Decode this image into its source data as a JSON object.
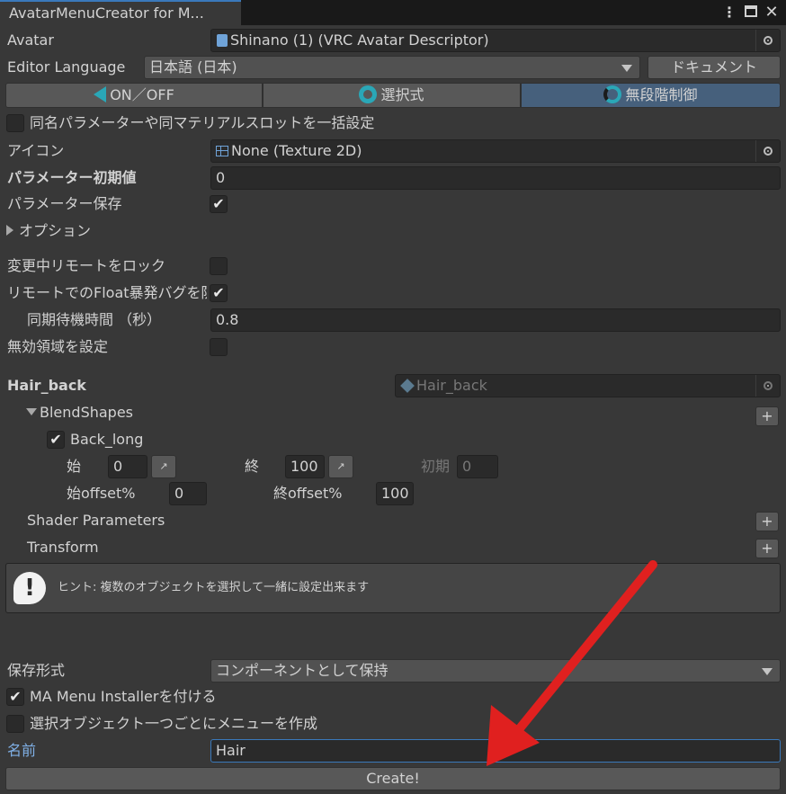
{
  "window": {
    "tab_title": "AvatarMenuCreator for M...",
    "menu_icon": "kebab-menu-icon",
    "maximize_icon": "maximize-icon",
    "close_icon": "close-icon"
  },
  "avatar": {
    "label": "Avatar",
    "value": "Shinano (1) (VRC Avatar Descriptor)"
  },
  "editor_language": {
    "label": "Editor Language",
    "value": "日本語 (日本)",
    "doc_button": "ドキュメント"
  },
  "modes": [
    {
      "label": "ON／OFF",
      "icon": "on-off-icon",
      "selected": false
    },
    {
      "label": "選択式",
      "icon": "choice-icon",
      "selected": false
    },
    {
      "label": "無段階制御",
      "icon": "radial-icon",
      "selected": true
    }
  ],
  "bulk_setting": {
    "label": "同名パラメーターや同マテリアルスロットを一括設定",
    "checked": false
  },
  "icon_field": {
    "label": "アイコン",
    "value": "None (Texture 2D)"
  },
  "param_default": {
    "label": "パラメーター初期値",
    "value": "0"
  },
  "param_save": {
    "label": "パラメーター保存",
    "checked": true
  },
  "options_foldout": {
    "label": "オプション"
  },
  "lock_remote": {
    "label": "変更中リモートをロック",
    "checked": false
  },
  "float_fix": {
    "label": "リモートでのFloat暴発バグを防",
    "checked": true
  },
  "sync_wait": {
    "label": "同期待機時間 （秒）",
    "value": "0.8"
  },
  "invalid_region": {
    "label": "無効領域を設定",
    "checked": false
  },
  "object": {
    "name": "Hair_back",
    "field_value": "Hair_back",
    "blendshapes_label": "BlendShapes",
    "shape": {
      "name": "Back_long",
      "checked": true,
      "start_label": "始",
      "start_value": "0",
      "end_label": "終",
      "end_value": "100",
      "initial_label": "初期",
      "initial_value": "0",
      "start_offset_label": "始offset%",
      "start_offset_value": "0",
      "end_offset_label": "終offset%",
      "end_offset_value": "100"
    },
    "shader_params_label": "Shader Parameters",
    "transform_label": "Transform",
    "plus": "+"
  },
  "hint": {
    "text": "ヒント: 複数のオブジェクトを選択して一緒に設定出来ます"
  },
  "save_format": {
    "label": "保存形式",
    "value": "コンポーネントとして保持"
  },
  "ma_installer": {
    "label": "MA Menu Installerを付ける",
    "checked": true
  },
  "per_object_menu": {
    "label": "選択オブジェクト一つごとにメニューを作成",
    "checked": false
  },
  "name_field": {
    "label": "名前",
    "value": "Hair"
  },
  "create_button": "Create!",
  "colors": {
    "background": "#383838",
    "field": "#2a2a2a",
    "selected_segment": "#46607c",
    "focus_border": "#3a79bb",
    "annotation_arrow": "#e0201f"
  }
}
